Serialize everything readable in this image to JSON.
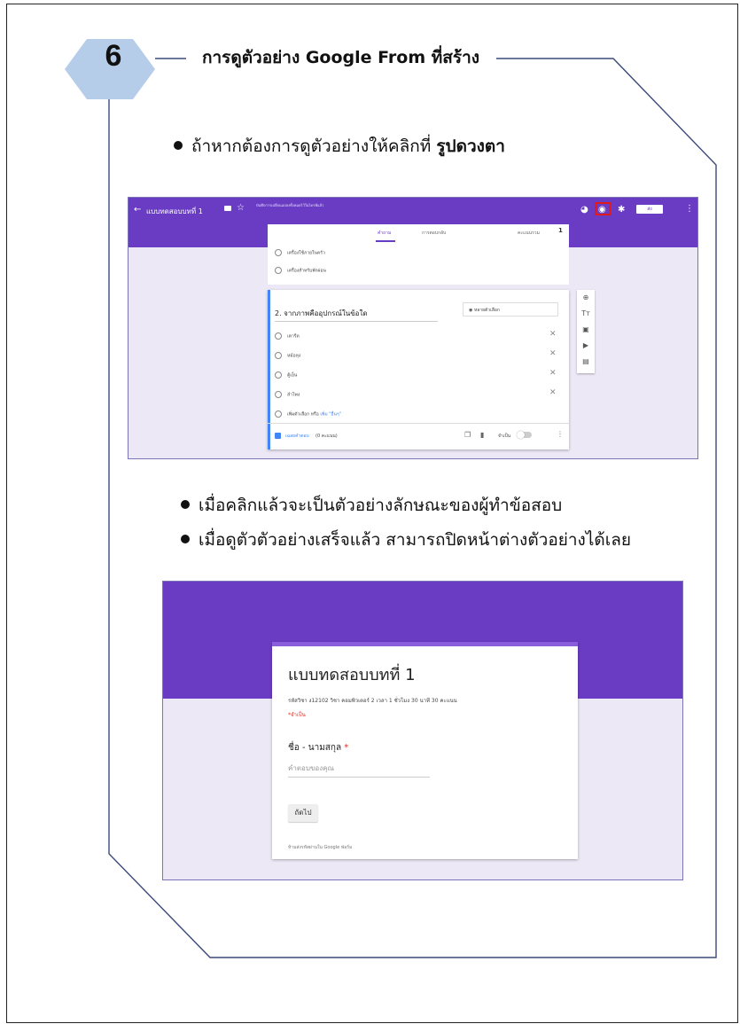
{
  "step": {
    "number": "6",
    "title": "การดูตัวอย่าง Google From ที่สร้าง"
  },
  "bullet1": {
    "text": "ถ้าหากต้องการดูตัวอย่างให้คลิกที่ ",
    "bold": "รูปดวงตา"
  },
  "editor": {
    "back_icon": "←",
    "form_title": "แบบทดสอบบทที่ 1",
    "star_icon": "☆",
    "save_note": "บันทึกการเปลี่ยนแปลงทั้งหมดไว้ในไดรฟ์แล้ว",
    "palette_icon": "◕",
    "eye_icon": "◉",
    "gear_icon": "✱",
    "send_label": "ส่ง",
    "more_icon": "⋮",
    "tab_questions": "คำถาม",
    "tab_responses": "การตอบกลับ",
    "total_points_label": "คะแนนรวม",
    "total_points": "1",
    "prev_options": [
      "เครื่องใช้ภายในครัว",
      "เครื่องสำหรับพักผ่อน"
    ],
    "question_title": "2. จากภาพคืออุปกรณ์ในข้อใด",
    "question_type": "หลายตัวเลือก",
    "options": [
      "เตารีด",
      "หม้อหุง",
      "ตู้เย็น",
      "ลำโพง"
    ],
    "add_option": "เพิ่มตัวเลือก หรือ",
    "add_other": "เพิ่ม \"อื่นๆ\"",
    "answer_key": "เฉลยคำตอบ",
    "points_label": "(0 คะแนน)",
    "required_label": "จำเป็น",
    "x_icon": "✕",
    "tools": [
      "⊕",
      "Tт",
      "▣",
      "▶",
      "▤"
    ]
  },
  "bullet2": "เมื่อคลิกแล้วจะเป็นตัวอย่างลักษณะของผู้ทำข้อสอบ",
  "bullet3": "เมื่อดูตัวตัวอย่างเสร็จแล้ว สามารถปิดหน้าต่างตัวอย่างได้เลย",
  "preview": {
    "title": "แบบทดสอบบทที่ 1",
    "description": "รหัสวิชา ง12102  วิชา คอมพิวเตอร์ 2  เวลา 1 ชั่วโมง 30 นาที  30  คะแนน",
    "required_note": "*จำเป็น",
    "question_label": "ชื่อ - นามสกุล",
    "required_star": "*",
    "answer_placeholder": "คำตอบของคุณ",
    "next_button": "ถัดไป",
    "footer": "ห้ามส่งรหัสผ่านใน Google ฟอร์ม"
  },
  "colors": {
    "header_purple": "#6a3cc3",
    "background_lavender": "#ede8f6",
    "highlight_red": "#e01a1a",
    "frame_blue": "#3b4a7a",
    "hexagon_fill": "#b6cdea"
  }
}
